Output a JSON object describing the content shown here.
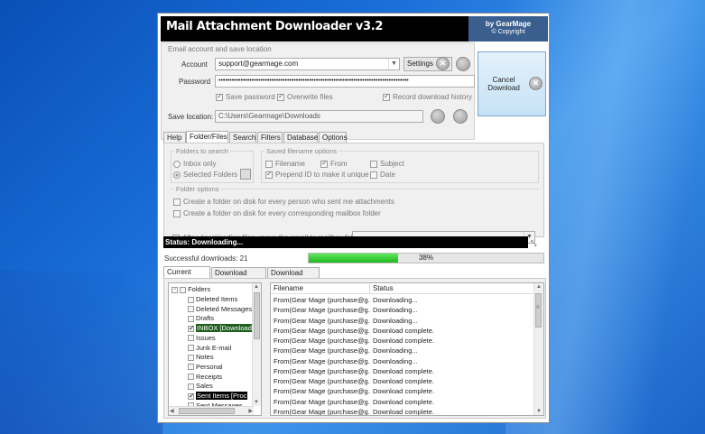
{
  "window": {
    "title": "Mail Attachment Downloader v3.2",
    "brand_line1": "by GearMage",
    "brand_line2": "© Copyright"
  },
  "account_group": {
    "legend": "Email account and save location",
    "account_label": "Account",
    "account_value": "support@gearmage.com",
    "settings_label": "Settings",
    "password_label": "Password",
    "password_value": "••••••••••••••••••••••••••••••••••••••••••••••••••••••••••••••••••••••••••••••••••••••",
    "save_password": "Save password",
    "overwrite_files": "Overwrite files",
    "record_history": "Record download history",
    "save_location_label": "Save location:",
    "save_location_value": "C:\\Users\\Gearmage\\Downloads"
  },
  "cancel_button": "Cancel Download",
  "tabs": [
    "Help",
    "Folder/Files",
    "Search",
    "Filters",
    "Database",
    "Options"
  ],
  "active_tab": "Folder/Files",
  "folder_files": {
    "folders_to_search": "Folders to search",
    "inbox_only": "Inbox only",
    "selected_folders": "Selected Folders",
    "saved_filename_options": "Saved filename options",
    "filename": "Filename",
    "from": "From",
    "subject": "Subject",
    "prepend_id": "Prepend ID to make it unique",
    "date": "Date",
    "folder_options": "Folder options",
    "opt_person": "Create a folder on disk for every person who sent me attachments",
    "opt_mailbox": "Create a folder on disk for every corresponding mailbox folder",
    "opt_move": "After downloading files, move the email to mailbox folder"
  },
  "status": {
    "text": "Status: Downloading...",
    "successful": "Successful downloads: 21",
    "progress_percent": 38,
    "progress_label": "38%"
  },
  "bottom_tabs": [
    "Current Status",
    "Download History",
    "Download Chart"
  ],
  "tree": {
    "root": "Folders",
    "items": [
      {
        "label": "Deleted Items",
        "checked": false,
        "style": ""
      },
      {
        "label": "Deleted Messages",
        "checked": false,
        "style": ""
      },
      {
        "label": "Drafts",
        "checked": false,
        "style": ""
      },
      {
        "label": "INBOX [Download",
        "checked": true,
        "style": "sel"
      },
      {
        "label": "Issues",
        "checked": false,
        "style": ""
      },
      {
        "label": "Junk E-mail",
        "checked": false,
        "style": ""
      },
      {
        "label": "Notes",
        "checked": false,
        "style": ""
      },
      {
        "label": "Personal",
        "checked": false,
        "style": ""
      },
      {
        "label": "Receipts",
        "checked": false,
        "style": ""
      },
      {
        "label": "Sales",
        "checked": false,
        "style": ""
      },
      {
        "label": "Sent Items [Proc",
        "checked": true,
        "style": "sel2"
      },
      {
        "label": "Sent Messages",
        "checked": false,
        "style": ""
      }
    ]
  },
  "grid": {
    "col_filename": "Filename",
    "col_status": "Status",
    "rows": [
      {
        "filename": "From(Gear Mage (purchase@g...",
        "status": "Downloading..."
      },
      {
        "filename": "From(Gear Mage (purchase@g...",
        "status": "Downloading..."
      },
      {
        "filename": "From(Gear Mage (purchase@g...",
        "status": "Downloading..."
      },
      {
        "filename": "From(Gear Mage (purchase@g...",
        "status": "Download complete."
      },
      {
        "filename": "From(Gear Mage (purchase@g...",
        "status": "Download complete."
      },
      {
        "filename": "From(Gear Mage (purchase@g...",
        "status": "Downloading..."
      },
      {
        "filename": "From(Gear Mage (purchase@g...",
        "status": "Downloading..."
      },
      {
        "filename": "From(Gear Mage (purchase@g...",
        "status": "Download complete."
      },
      {
        "filename": "From(Gear Mage (purchase@g...",
        "status": "Download complete."
      },
      {
        "filename": "From(Gear Mage (purchase@g...",
        "status": "Download complete."
      },
      {
        "filename": "From(Gear Mage (purchase@g...",
        "status": "Download complete."
      },
      {
        "filename": "From(Gear Mage (purchase@g...",
        "status": "Download complete."
      }
    ]
  }
}
